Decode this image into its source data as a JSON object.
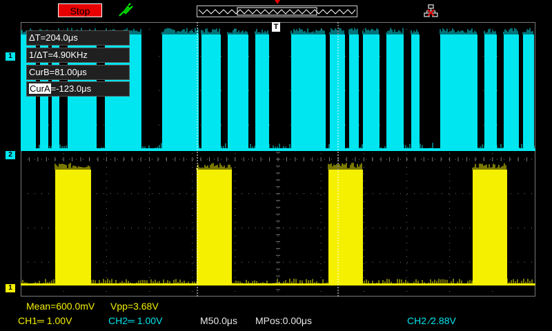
{
  "header": {
    "run_state": "Stop",
    "trigger_marker": "T"
  },
  "cursors": {
    "delta_t": "ΔT=204.0μs",
    "inv_delta_t": "1/ΔT=4.90KHz",
    "cur_b": "CurB=81.00μs",
    "cur_a_label": "CurA",
    "cur_a_value": "=-123.0μs"
  },
  "channels": {
    "ch1_marker": "1",
    "ch2_marker": "2",
    "ch1_level_marker": "1"
  },
  "measurements": {
    "mean": "Mean=600.0mV",
    "vpp": "Vpp=3.68V"
  },
  "status": {
    "ch1": "CH1═ 1.00V",
    "ch2": "CH2═ 1.00V",
    "timebase": "M50.0μs",
    "mpos": "MPos:0.00μs",
    "trigger": "CH2 ⁄2.88V"
  },
  "colors": {
    "ch1": "#f4f000",
    "ch2": "#00e6f0",
    "run_state_bg": "#e80000",
    "grid": "#7a7a7a"
  },
  "icons": [
    "probe-icon",
    "network-icon",
    "trigger-marker-icon"
  ]
}
